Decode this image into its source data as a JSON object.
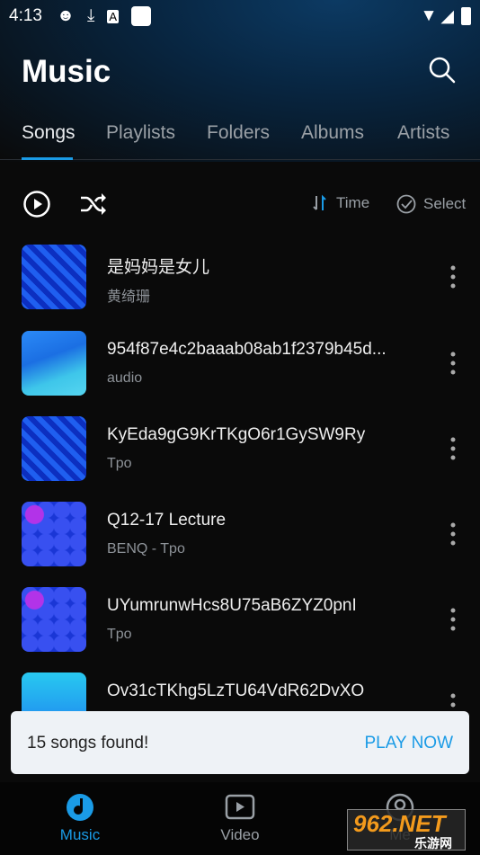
{
  "status_bar": {
    "time": "4:13"
  },
  "header": {
    "title": "Music",
    "search_icon": "search-icon"
  },
  "tabs": [
    {
      "label": "Songs",
      "active": true
    },
    {
      "label": "Playlists"
    },
    {
      "label": "Folders"
    },
    {
      "label": "Albums"
    },
    {
      "label": "Artists"
    }
  ],
  "toolbar": {
    "sort_label": "Time",
    "select_label": "Select"
  },
  "songs": [
    {
      "title": "是妈妈是女儿",
      "subtitle": "黄绮珊"
    },
    {
      "title": "954f87e4c2baaab08ab1f2379b45d...",
      "subtitle": "audio"
    },
    {
      "title": "KyEda9gG9KrTKgO6r1GySW9Ry",
      "subtitle": "Tpo"
    },
    {
      "title": "Q12-17 Lecture",
      "subtitle": "BENQ - Tpo"
    },
    {
      "title": "UYumrunwHcs8U75aB6ZYZ0pnI",
      "subtitle": "Tpo"
    },
    {
      "title": "Ov31cTKhg5LzTU64VdR62DvXO",
      "subtitle": ""
    }
  ],
  "snackbar": {
    "message": "15 songs found!",
    "action": "PLAY NOW"
  },
  "bottom_nav": [
    {
      "label": "Music",
      "active": true
    },
    {
      "label": "Video"
    },
    {
      "label": "Me"
    }
  ],
  "watermark": {
    "text": "962.NET",
    "subtext": "乐游网"
  },
  "colors": {
    "accent": "#1a9be6",
    "background": "#0a0a0a",
    "snackbar": "#eef2f6"
  }
}
